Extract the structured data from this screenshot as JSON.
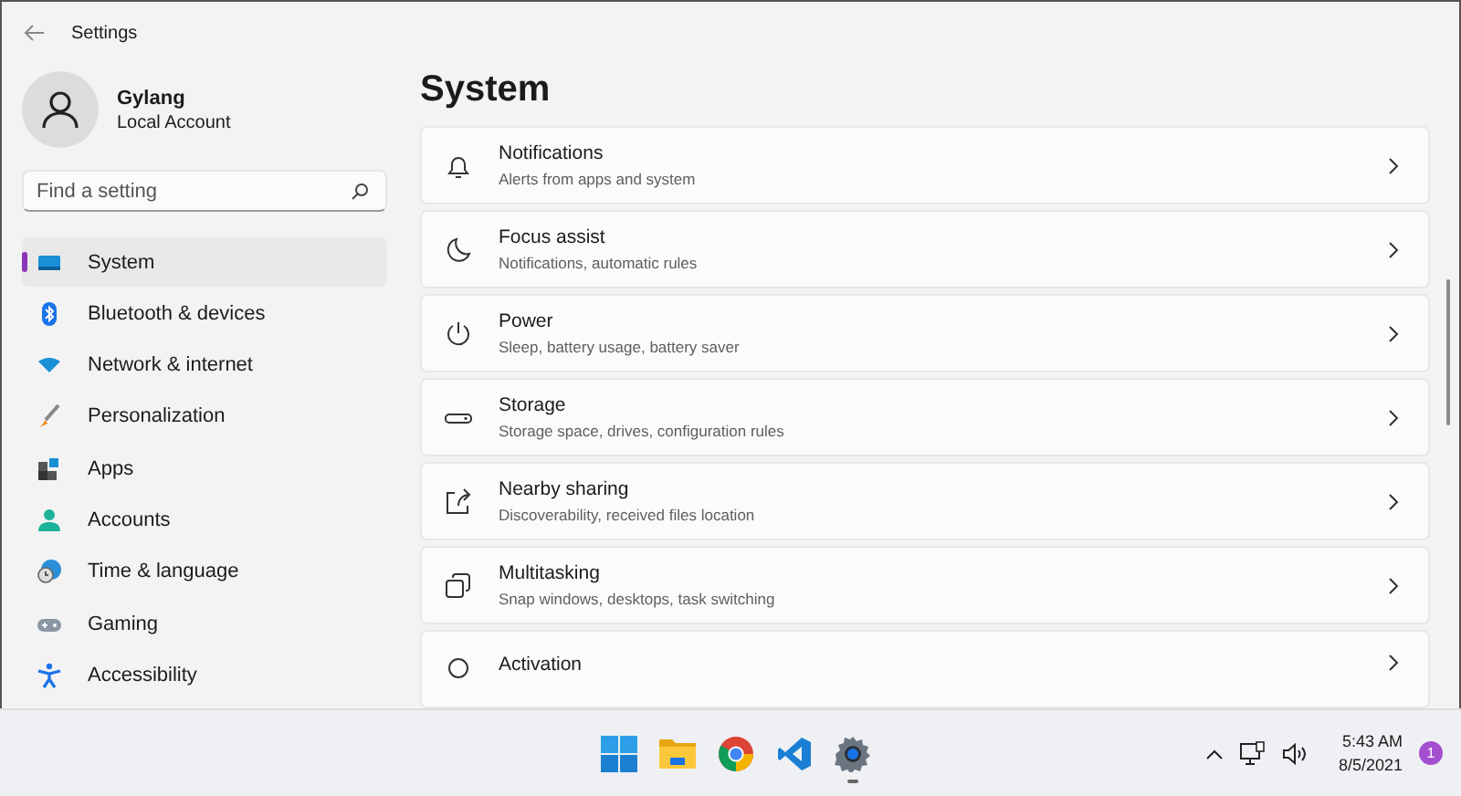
{
  "window": {
    "title": "Settings"
  },
  "account": {
    "name": "Gylang",
    "type": "Local Account"
  },
  "search": {
    "placeholder": "Find a setting"
  },
  "sidebar": {
    "items": [
      {
        "label": "System",
        "selected": true
      },
      {
        "label": "Bluetooth & devices",
        "selected": false
      },
      {
        "label": "Network & internet",
        "selected": false
      },
      {
        "label": "Personalization",
        "selected": false
      },
      {
        "label": "Apps",
        "selected": false
      },
      {
        "label": "Accounts",
        "selected": false
      },
      {
        "label": "Time & language",
        "selected": false
      },
      {
        "label": "Gaming",
        "selected": false
      },
      {
        "label": "Accessibility",
        "selected": false
      }
    ]
  },
  "page": {
    "title": "System",
    "cards": [
      {
        "title": "Notifications",
        "subtitle": "Alerts from apps and system"
      },
      {
        "title": "Focus assist",
        "subtitle": "Notifications, automatic rules"
      },
      {
        "title": "Power",
        "subtitle": "Sleep, battery usage, battery saver"
      },
      {
        "title": "Storage",
        "subtitle": "Storage space, drives, configuration rules"
      },
      {
        "title": "Nearby sharing",
        "subtitle": "Discoverability, received files location"
      },
      {
        "title": "Multitasking",
        "subtitle": "Snap windows, desktops, task switching"
      },
      {
        "title": "Activation"
      }
    ]
  },
  "taskbar": {
    "apps": [
      {
        "kind": "start",
        "running": false
      },
      {
        "kind": "explorer",
        "running": false
      },
      {
        "kind": "chrome",
        "running": false
      },
      {
        "kind": "vscode",
        "running": false
      },
      {
        "kind": "settings",
        "running": true
      }
    ],
    "time": "5:43 AM",
    "date": "8/5/2021",
    "notification_count": "1"
  }
}
